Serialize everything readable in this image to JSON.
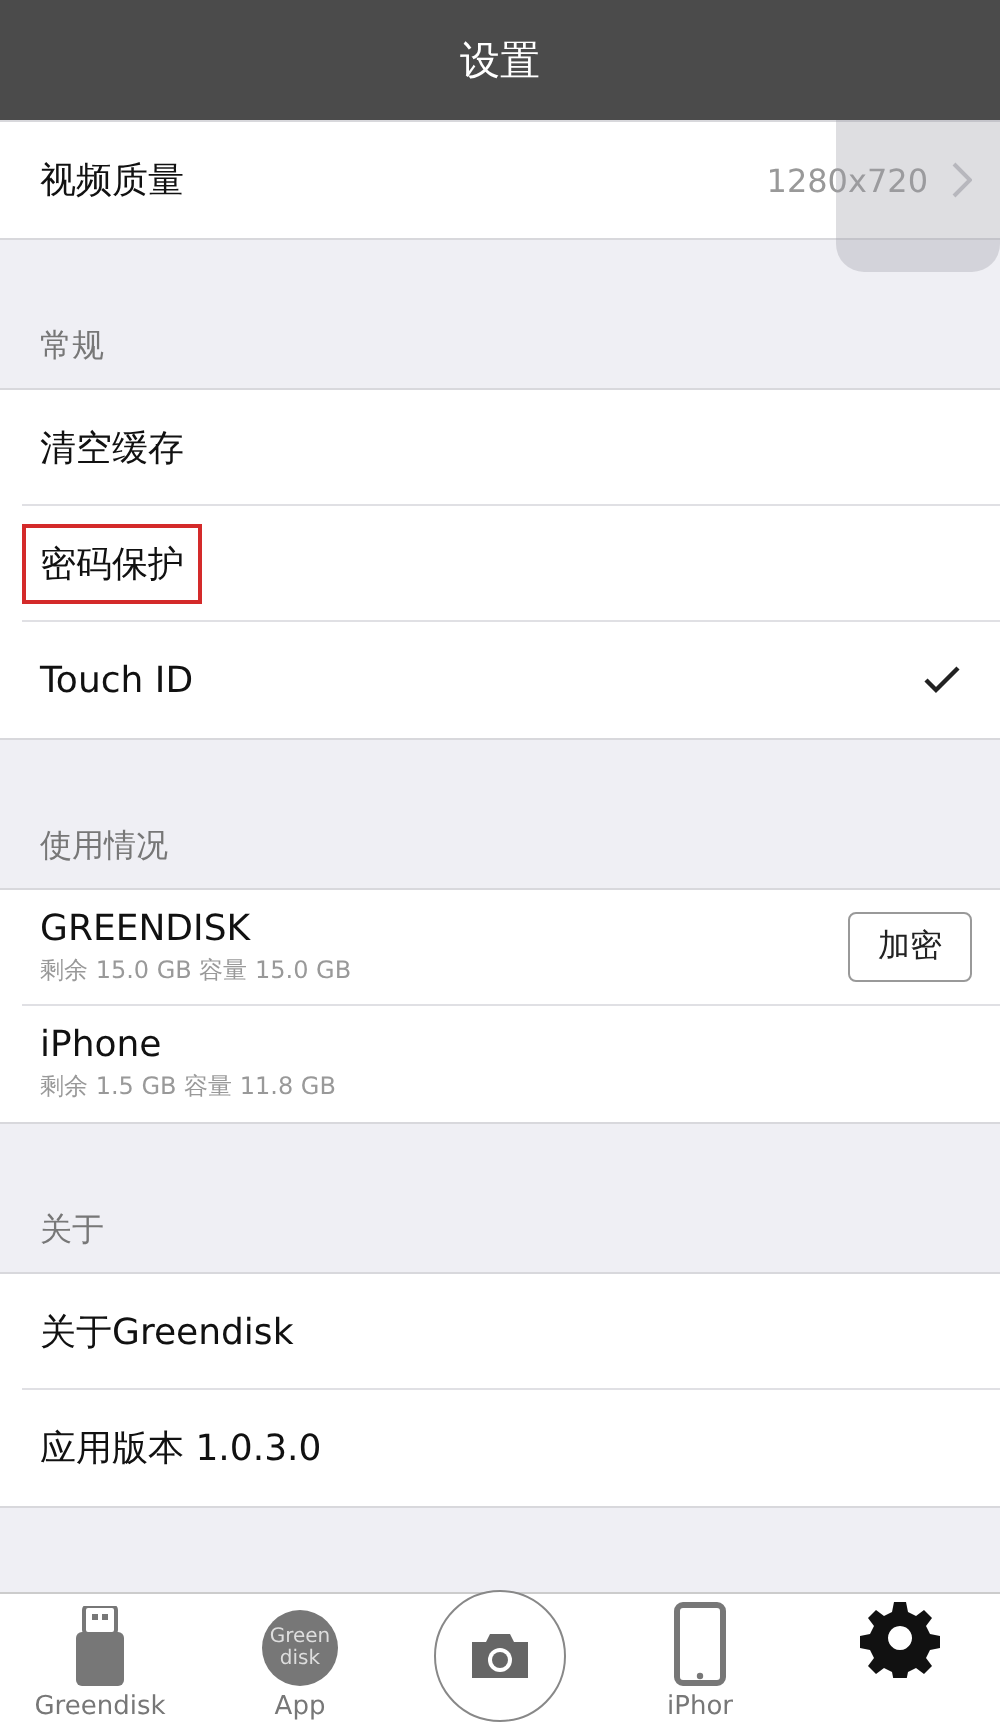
{
  "nav_bar": {
    "title": "设置"
  },
  "sections": [
    {
      "rows": [
        {
          "kind": "value",
          "label": "视频质量",
          "value": "1280x720",
          "highlighted": false
        }
      ]
    },
    {
      "header": "常规",
      "rows": [
        {
          "kind": "plain",
          "label": "清空缓存",
          "highlighted": false
        },
        {
          "kind": "plain",
          "label": "密码保护",
          "highlighted": true
        },
        {
          "kind": "check",
          "label": "Touch ID",
          "checked": true,
          "highlighted": false
        }
      ]
    },
    {
      "header": "使用情况",
      "rows": [
        {
          "kind": "storage",
          "label": "GREENDISK",
          "detail": "剩余 15.0 GB 容量 15.0 GB",
          "button": "加密",
          "highlighted": false
        },
        {
          "kind": "storage",
          "label": "iPhone",
          "detail": "剩余 1.5 GB 容量 11.8 GB",
          "highlighted": false
        }
      ]
    },
    {
      "header": "关于",
      "rows": [
        {
          "kind": "plain",
          "label": "关于Greendisk",
          "highlighted": false
        },
        {
          "kind": "plain",
          "label": "应用版本 1.0.3.0",
          "highlighted": false
        }
      ]
    }
  ],
  "tab_bar": [
    {
      "kind": "usb",
      "label": "Greendisk",
      "selected": false
    },
    {
      "kind": "logo",
      "logo_text": [
        "Green",
        "disk"
      ],
      "label": "App",
      "selected": false
    },
    {
      "kind": "camera",
      "selected": false
    },
    {
      "kind": "phone",
      "label": "iPhor",
      "selected": false
    },
    {
      "kind": "gear",
      "selected": true
    }
  ]
}
